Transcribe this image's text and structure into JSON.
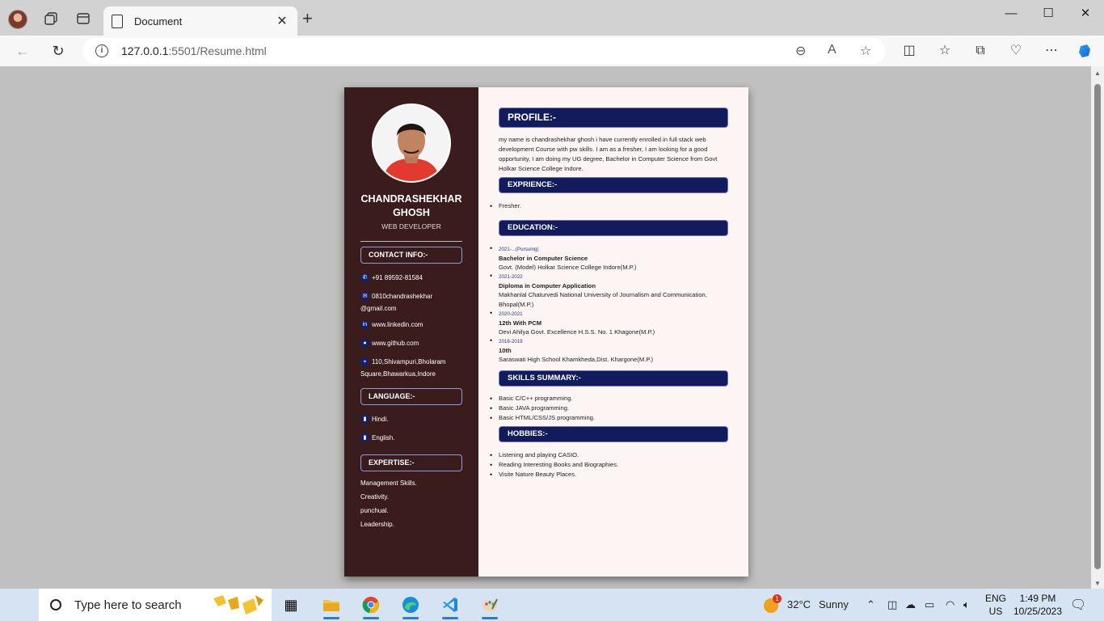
{
  "browser": {
    "tab_title": "Document",
    "url_host": "127.0.0.1",
    "url_path": ":5501/Resume.html"
  },
  "resume": {
    "name": "CHANDRASHEKHAR GHOSH",
    "role": "WEB DEVELOPER",
    "contact_heading": "CONTACT INFO:-",
    "contact": {
      "phone": "+91 89592-81584",
      "email": "0810chandrashekhar @gmail.com",
      "linkedin": "www.linkedin.com",
      "github": "www.github.com",
      "address": "110,Shivampuri,Bholaram Square,Bhawarkua,Indore"
    },
    "language_heading": "LANGUAGE:-",
    "languages": [
      "Hindi.",
      "English."
    ],
    "expertise_heading": "EXPERTISE:-",
    "expertise": [
      "Management Skills.",
      "Creativity.",
      "punchual.",
      "Leadership."
    ],
    "profile_heading": "PROFILE:-",
    "profile_text": "my name is chandrashekhar ghosh i have currently enrolled in full stack web development Course with pw skills. I am as a fresher, I am looking for a good opportunity, I am doing my UG degree, Bachelor in Computer Science from Govt Holkar Science College Indore.",
    "experience_heading": "EXPRIENCE:-",
    "experience": [
      "Fresher."
    ],
    "education_heading": "EDUCATION:-",
    "education": [
      {
        "year": "2021-...(Pursuing)",
        "degree": "Bachelor in Computer Science",
        "institute": "Govt. (Model) Holkar Science College Indore(M.P.)"
      },
      {
        "year": "2021-2022",
        "degree": "Diploma in Computer Application",
        "institute": "Makhanlal Chaturvedi National University of Journalism and Communication, Bhopal(M.P.)"
      },
      {
        "year": "2020-2021",
        "degree": "12th With PCM",
        "institute": "Devi Ahilya Govt. Excellence H.S.S. No. 1 Khagone(M.P.)"
      },
      {
        "year": "2018-2019",
        "degree": "10th",
        "institute": "Saraswati High School Khamkheda,Dist. Khargone(M.P.)"
      }
    ],
    "skills_heading": "SKILLS SUMMARY:-",
    "skills": [
      "Basic C/C++ programming.",
      "Basic JAVA programming.",
      "Basic HTML/CSS/JS programming."
    ],
    "hobbies_heading": "HOBBIES:-",
    "hobbies": [
      "Listening and playing CASIO.",
      "Reading Interesting Books and Biographies.",
      "Visite Nature Beauty Places."
    ]
  },
  "taskbar": {
    "search_placeholder": "Type here to search",
    "weather_temp": "32°C",
    "weather_text": "Sunny",
    "weather_badge": "1",
    "lang_line1": "ENG",
    "lang_line2": "US",
    "time": "1:49 PM",
    "date": "10/25/2023"
  },
  "icons": [
    "profile-avatar-icon",
    "workspaces-icon",
    "tab-actions-icon",
    "page-icon",
    "close-icon",
    "plus-icon",
    "minimize-icon",
    "maximize-icon",
    "back-icon",
    "refresh-icon",
    "info-icon",
    "zoom-out-icon",
    "read-aloud-icon",
    "favorite-star-icon",
    "split-screen-icon",
    "favorites-icon",
    "collections-icon",
    "browser-essentials-icon",
    "more-icon",
    "copilot-icon",
    "phone-icon",
    "email-icon",
    "linkedin-icon",
    "github-icon",
    "location-icon",
    "book-icon"
  ],
  "colors": {
    "sidebar": "#3a1c1c",
    "heading_bg": "#121b5c",
    "page_bg": "#fdf5f4",
    "year_text": "#1d3a8a"
  }
}
